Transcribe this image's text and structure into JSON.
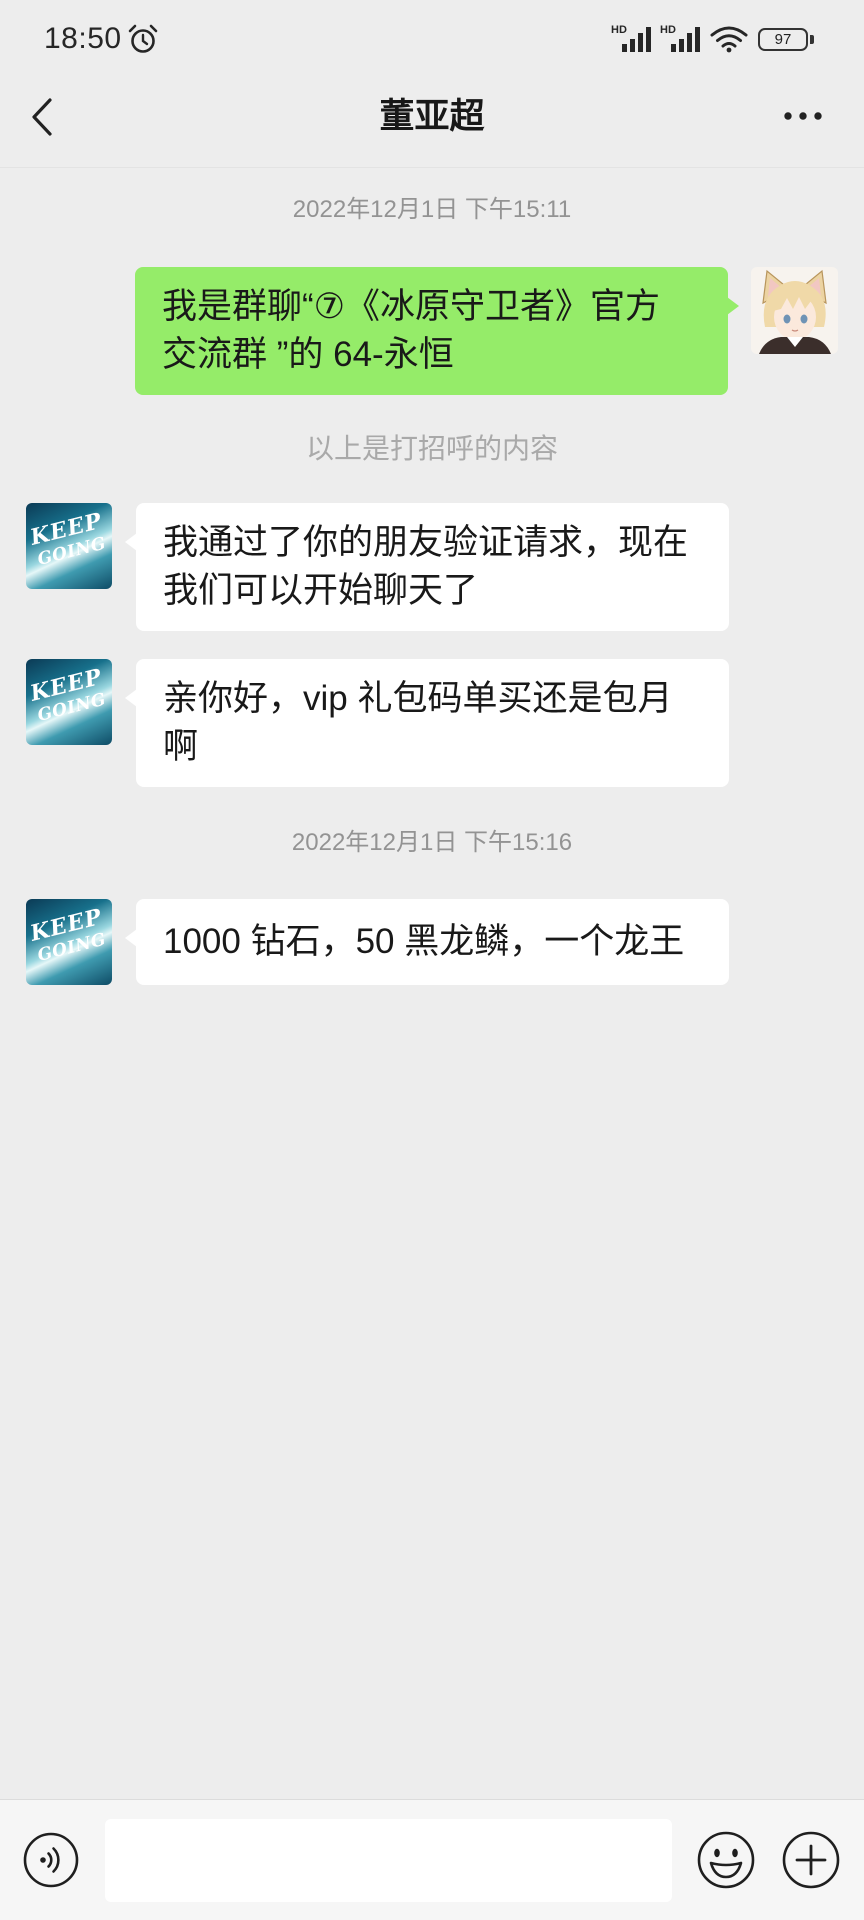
{
  "status_bar": {
    "time": "18:50",
    "network_1": "HD",
    "network_2": "HD",
    "battery": "97",
    "icons": [
      "alarm-icon",
      "signal-icon",
      "signal-icon",
      "wifi-icon",
      "battery-icon"
    ]
  },
  "header": {
    "title": "董亚超",
    "back_icon": "chevron-left-icon",
    "more_icon": "more-dots-icon"
  },
  "chat": {
    "timestamps": [
      "2022年12月1日 下午15:11",
      "2022年12月1日 下午15:16"
    ],
    "greeting_note": "以上是打招呼的内容",
    "messages": [
      {
        "outgoing": true,
        "lines": [
          "我是群聊“⑦《冰原守卫者》官方",
          "交流群 ”的 64-永恒"
        ]
      },
      {
        "outgoing": false,
        "lines": [
          "我通过了你的朋友验证请求，现在",
          "我们可以开始聊天了"
        ]
      },
      {
        "outgoing": false,
        "lines": [
          "亲你好，vip 礼包码单买还是包月",
          "啊"
        ]
      },
      {
        "outgoing": false,
        "lines": [
          "1000 钻石，50 黑龙鳞，一个龙王"
        ]
      }
    ]
  },
  "contact_avatar": {
    "logo_lines": [
      "KEEP",
      "GOING"
    ]
  },
  "input_bar": {
    "icons": [
      "voice-icon",
      "emoji-icon",
      "plus-icon"
    ]
  },
  "colors": {
    "background": "#ededed",
    "outgoing_bubble": "#95ec69",
    "incoming_bubble": "#ffffff",
    "bottom_bar": "#f6f6f6"
  }
}
